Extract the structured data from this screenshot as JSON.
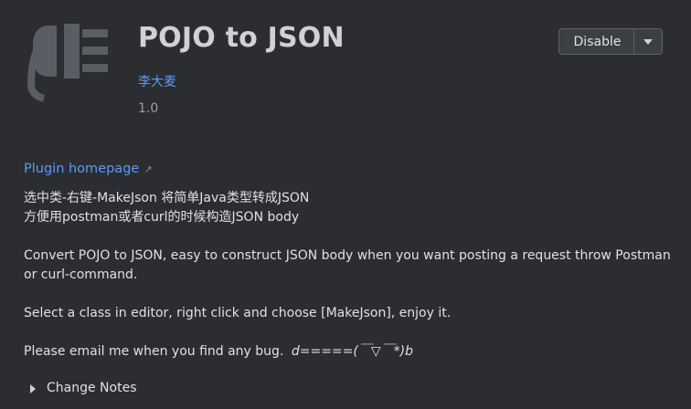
{
  "plugin": {
    "name": "POJO to JSON",
    "vendor": "李大麦",
    "version": "1.0",
    "icon": "plug-icon"
  },
  "actions": {
    "disable_label": "Disable",
    "dropdown_icon": "chevron-down-icon"
  },
  "description": {
    "homepage_label": "Plugin homepage",
    "homepage_icon": "external-link-icon",
    "cn_line1": "选中类-右键-MakeJson 将简单Java类型转成JSON",
    "cn_line2": "方便用postman或者curl的时候构造JSON body",
    "en_para1": "Convert POJO to JSON, easy to construct JSON body when you want posting a request throw Postman or curl-command.",
    "en_para2": "Select a class in editor, right click and choose [MakeJson], enjoy it.",
    "en_para3": "Please email me when you find any bug.",
    "emoticon": "d=====(￣▽￣*)b"
  },
  "change_notes": {
    "label": "Change Notes",
    "expander_icon": "triangle-right-icon"
  },
  "colors": {
    "background": "#2b2d30",
    "link": "#589df6",
    "text": "#dfe1e5",
    "icon": "#5a5d63"
  }
}
